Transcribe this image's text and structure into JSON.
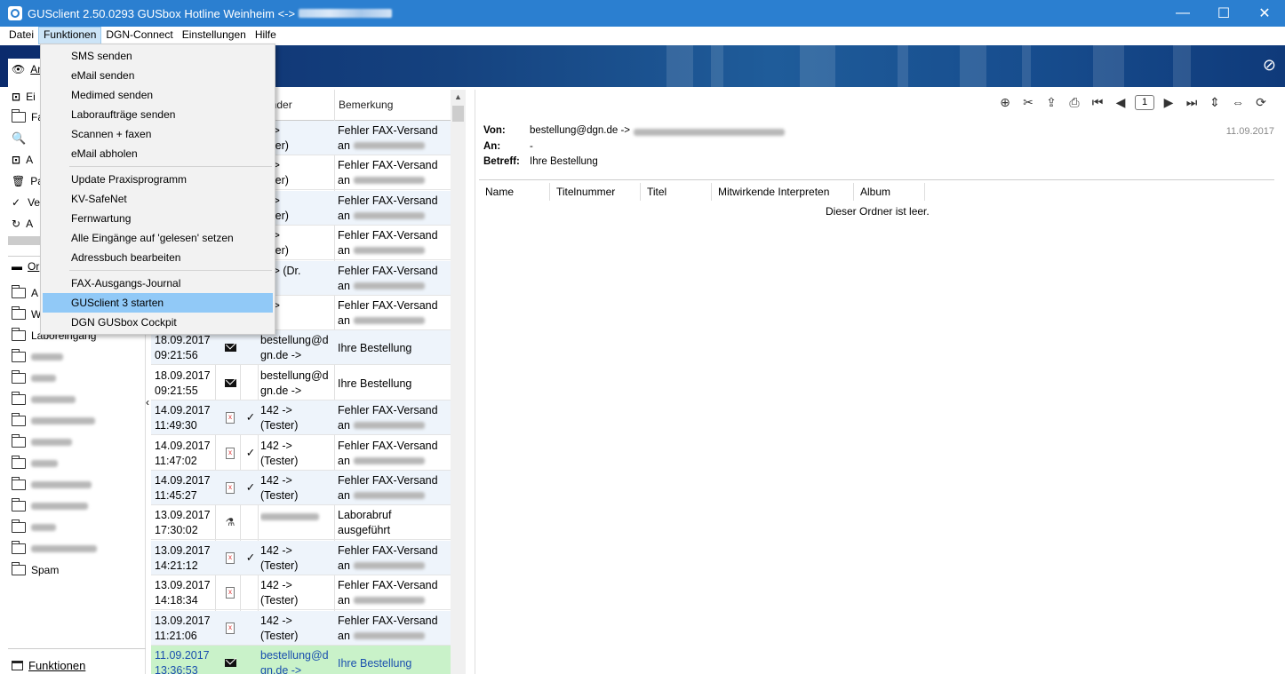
{
  "window": {
    "title": "GUSclient 2.50.0293  GUSbox Hotline Weinheim  <->  ",
    "controls": [
      "—",
      "☐",
      "✕"
    ]
  },
  "menubar": [
    "Datei",
    "Funktionen",
    "DGN-Connect",
    "Einstellungen",
    "Hilfe"
  ],
  "leftnav": {
    "items": [
      "An",
      "Ei",
      "Fa",
      "",
      "A",
      "Pa",
      "Ve",
      "A"
    ],
    "section2": "Or",
    "folders": [
      "A",
      "W",
      "Laboreingang",
      "",
      "",
      "",
      "",
      "",
      "",
      "",
      "",
      "",
      "",
      "Spam"
    ],
    "bottom": "Funktionen"
  },
  "dropdown": {
    "items": [
      "SMS senden",
      "eMail senden",
      "Medimed senden",
      "Laboraufträge senden",
      "Scannen + faxen",
      "eMail abholen",
      "Update Praxisprogramm",
      "KV-SafeNet",
      "Fernwartung",
      "Alle Eingänge auf 'gelesen' setzen",
      "Adressbuch bearbeiten",
      "FAX-Ausgangs-Journal",
      "GUSclient 3 starten",
      "DGN GUSbox Cockpit"
    ],
    "highlighted": "GUSclient 3 starten"
  },
  "msglist": {
    "headers": {
      "sender": "sender",
      "note": "Bemerkung"
    },
    "rows": [
      {
        "date": "",
        "time": "",
        "icon": "",
        "check": "",
        "sender1": "2 ->",
        "sender2": "ester)",
        "note1": "Fehler FAX-Versand",
        "note2": "an"
      },
      {
        "date": "",
        "time": "",
        "icon": "",
        "check": "",
        "sender1": "2 ->",
        "sender2": "ester)",
        "note1": "Fehler FAX-Versand",
        "note2": "an"
      },
      {
        "date": "",
        "time": "",
        "icon": "",
        "check": "",
        "sender1": "2 ->",
        "sender2": "ester)",
        "note1": "Fehler FAX-Versand",
        "note2": "an"
      },
      {
        "date": "",
        "time": "",
        "icon": "",
        "check": "",
        "sender1": "2 ->",
        "sender2": "ester)",
        "note1": "Fehler FAX-Versand",
        "note2": "an"
      },
      {
        "date": "",
        "time": "",
        "icon": "",
        "check": "",
        "sender1": "2 -> (Dr.",
        "sender2": "d.",
        "note1": "Fehler FAX-Versand",
        "note2": "an"
      },
      {
        "date": "",
        "time": "",
        "icon": "",
        "check": "",
        "sender1": "2 ->",
        "sender2": "",
        "note1": "Fehler FAX-Versand",
        "note2": "an"
      },
      {
        "date": "18.09.2017",
        "time": "09:21:56",
        "icon": "mail",
        "check": "",
        "sender1": "bestellung@d",
        "sender2": "gn.de ->",
        "note1": "Ihre Bestellung",
        "note2": ""
      },
      {
        "date": "18.09.2017",
        "time": "09:21:55",
        "icon": "mail",
        "check": "",
        "sender1": "bestellung@d",
        "sender2": "gn.de ->",
        "note1": "Ihre Bestellung",
        "note2": ""
      },
      {
        "date": "14.09.2017",
        "time": "11:49:30",
        "icon": "fax",
        "check": "✓",
        "sender1": "142 ->",
        "sender2": "(Tester)",
        "note1": "Fehler FAX-Versand",
        "note2": "an"
      },
      {
        "date": "14.09.2017",
        "time": "11:47:02",
        "icon": "fax",
        "check": "✓",
        "sender1": "142 ->",
        "sender2": "(Tester)",
        "note1": "Fehler FAX-Versand",
        "note2": "an"
      },
      {
        "date": "14.09.2017",
        "time": "11:45:27",
        "icon": "fax",
        "check": "✓",
        "sender1": "142 ->",
        "sender2": "(Tester)",
        "note1": "Fehler FAX-Versand",
        "note2": "an"
      },
      {
        "date": "13.09.2017",
        "time": "17:30:02",
        "icon": "flask",
        "check": "",
        "sender1": "",
        "sender2": "",
        "note1": "Laborabruf",
        "note2": "ausgeführt"
      },
      {
        "date": "13.09.2017",
        "time": "14:21:12",
        "icon": "fax",
        "check": "✓",
        "sender1": "142 ->",
        "sender2": "(Tester)",
        "note1": "Fehler FAX-Versand",
        "note2": "an"
      },
      {
        "date": "13.09.2017",
        "time": "14:18:34",
        "icon": "fax",
        "check": "",
        "sender1": "142 ->",
        "sender2": "(Tester)",
        "note1": "Fehler FAX-Versand",
        "note2": "an"
      },
      {
        "date": "13.09.2017",
        "time": "11:21:06",
        "icon": "fax",
        "check": "",
        "sender1": "142 ->",
        "sender2": "(Tester)",
        "note1": "Fehler FAX-Versand",
        "note2": "an"
      },
      {
        "date": "11.09.2017",
        "time": "13:36:53",
        "icon": "mail",
        "check": "",
        "sender1": "bestellung@d",
        "sender2": "gn.de ->",
        "note1": "Ihre Bestellung",
        "note2": ""
      }
    ],
    "selected_index": 15
  },
  "preview": {
    "page": "1",
    "from_label": "Von:",
    "from_value": "bestellung@dgn.de ->",
    "to_label": "An:",
    "to_value": "-",
    "subject_label": "Betreff:",
    "subject_value": "Ihre Bestellung",
    "date": "11.09.2017",
    "columns": [
      "Name",
      "Titelnummer",
      "Titel",
      "Mitwirkende Interpreten",
      "Album"
    ],
    "empty_text": "Dieser Ordner ist leer."
  }
}
